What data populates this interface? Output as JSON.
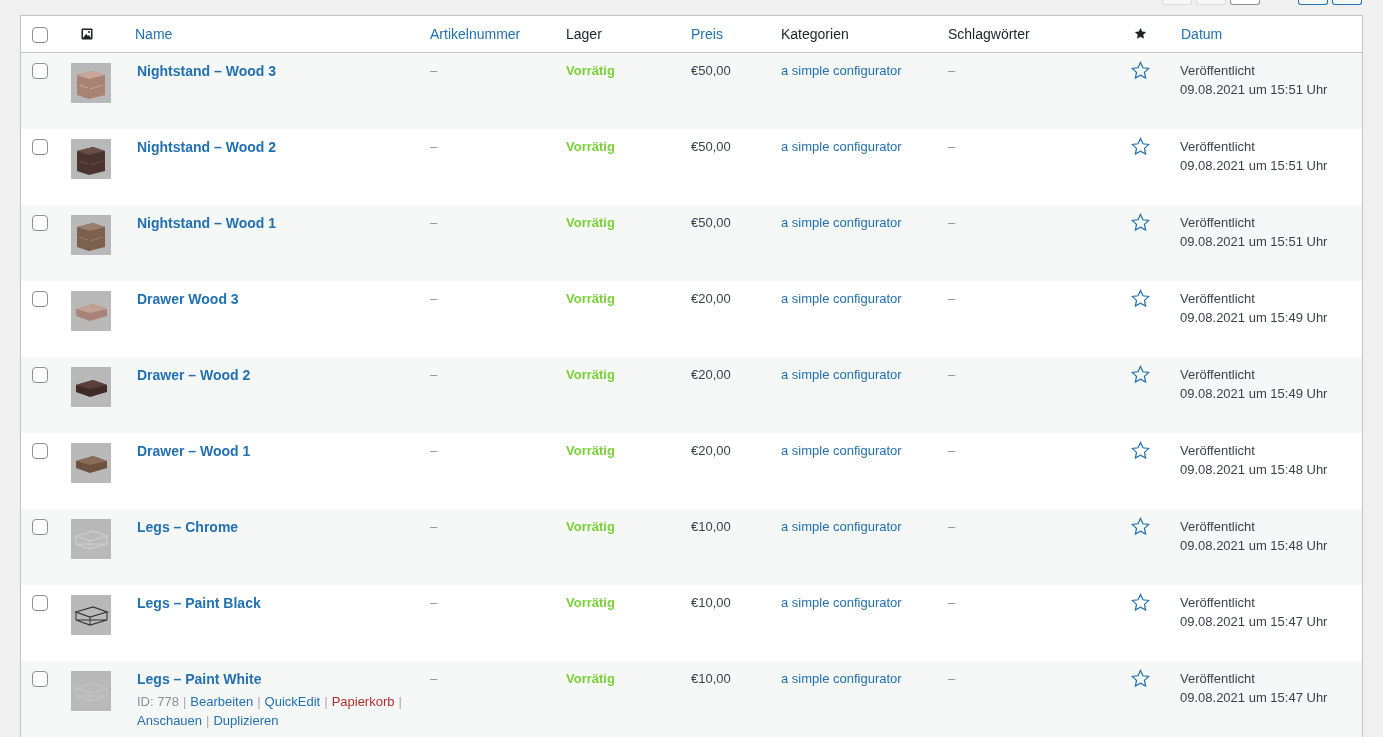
{
  "table": {
    "select_all": {
      "checked": false
    },
    "columns": [
      {
        "kind": "thumb"
      },
      {
        "kind": "text",
        "label": "Name",
        "sortable": true
      },
      {
        "kind": "text",
        "label": "Artikelnummer",
        "sortable": true
      },
      {
        "kind": "text",
        "label": "Lager",
        "sortable": false
      },
      {
        "kind": "text",
        "label": "Preis",
        "sortable": true
      },
      {
        "kind": "text",
        "label": "Kategorien",
        "sortable": false
      },
      {
        "kind": "text",
        "label": "Schlagwörter",
        "sortable": false
      },
      {
        "kind": "featured"
      },
      {
        "kind": "text",
        "label": "Datum",
        "sortable": true
      }
    ],
    "rows": [
      {
        "checked": false,
        "name": "Nightstand – Wood 3",
        "sku": "–",
        "stock": "Vorrätig",
        "in_stock": true,
        "price": "€50,00",
        "category": "a simple configurator",
        "tags": "–",
        "featured": false,
        "status": "Veröffentlicht",
        "date": "09.08.2021 um 15:51 Uhr"
      },
      {
        "checked": false,
        "name": "Nightstand – Wood 2",
        "sku": "–",
        "stock": "Vorrätig",
        "in_stock": true,
        "price": "€50,00",
        "category": "a simple configurator",
        "tags": "–",
        "featured": false,
        "status": "Veröffentlicht",
        "date": "09.08.2021 um 15:51 Uhr"
      },
      {
        "checked": false,
        "name": "Nightstand – Wood 1",
        "sku": "–",
        "stock": "Vorrätig",
        "in_stock": true,
        "price": "€50,00",
        "category": "a simple configurator",
        "tags": "–",
        "featured": false,
        "status": "Veröffentlicht",
        "date": "09.08.2021 um 15:51 Uhr"
      },
      {
        "checked": false,
        "name": "Drawer Wood 3",
        "sku": "–",
        "stock": "Vorrätig",
        "in_stock": true,
        "price": "€20,00",
        "category": "a simple configurator",
        "tags": "–",
        "featured": false,
        "status": "Veröffentlicht",
        "date": "09.08.2021 um 15:49 Uhr"
      },
      {
        "checked": false,
        "name": "Drawer – Wood 2",
        "sku": "–",
        "stock": "Vorrätig",
        "in_stock": true,
        "price": "€20,00",
        "category": "a simple configurator",
        "tags": "–",
        "featured": false,
        "status": "Veröffentlicht",
        "date": "09.08.2021 um 15:49 Uhr"
      },
      {
        "checked": false,
        "name": "Drawer – Wood 1",
        "sku": "–",
        "stock": "Vorrätig",
        "in_stock": true,
        "price": "€20,00",
        "category": "a simple configurator",
        "tags": "–",
        "featured": false,
        "status": "Veröffentlicht",
        "date": "09.08.2021 um 15:48 Uhr"
      },
      {
        "checked": false,
        "name": "Legs – Chrome",
        "sku": "–",
        "stock": "Vorrätig",
        "in_stock": true,
        "price": "€10,00",
        "category": "a simple configurator",
        "tags": "–",
        "featured": false,
        "status": "Veröffentlicht",
        "date": "09.08.2021 um 15:48 Uhr"
      },
      {
        "checked": false,
        "name": "Legs – Paint Black",
        "sku": "–",
        "stock": "Vorrätig",
        "in_stock": true,
        "price": "€10,00",
        "category": "a simple configurator",
        "tags": "–",
        "featured": false,
        "status": "Veröffentlicht",
        "date": "09.08.2021 um 15:47 Uhr"
      },
      {
        "checked": false,
        "name": "Legs – Paint White",
        "sku": "–",
        "stock": "Vorrätig",
        "in_stock": true,
        "price": "€10,00",
        "category": "a simple configurator",
        "tags": "–",
        "featured": false,
        "status": "Veröffentlicht",
        "date": "09.08.2021 um 15:47 Uhr",
        "row_actions": [
          {
            "kind": "id",
            "label": "ID: 778",
            "separator": "|"
          },
          {
            "kind": "link",
            "label": "Bearbeiten",
            "separator": "|"
          },
          {
            "kind": "link",
            "label": "QuickEdit",
            "separator": "|"
          },
          {
            "kind": "delete",
            "label": "Papierkorb",
            "separator": "|"
          },
          {
            "kind": "link",
            "label": "Anschauen",
            "separator": "|"
          },
          {
            "kind": "link",
            "label": "Duplizieren"
          }
        ]
      }
    ]
  }
}
